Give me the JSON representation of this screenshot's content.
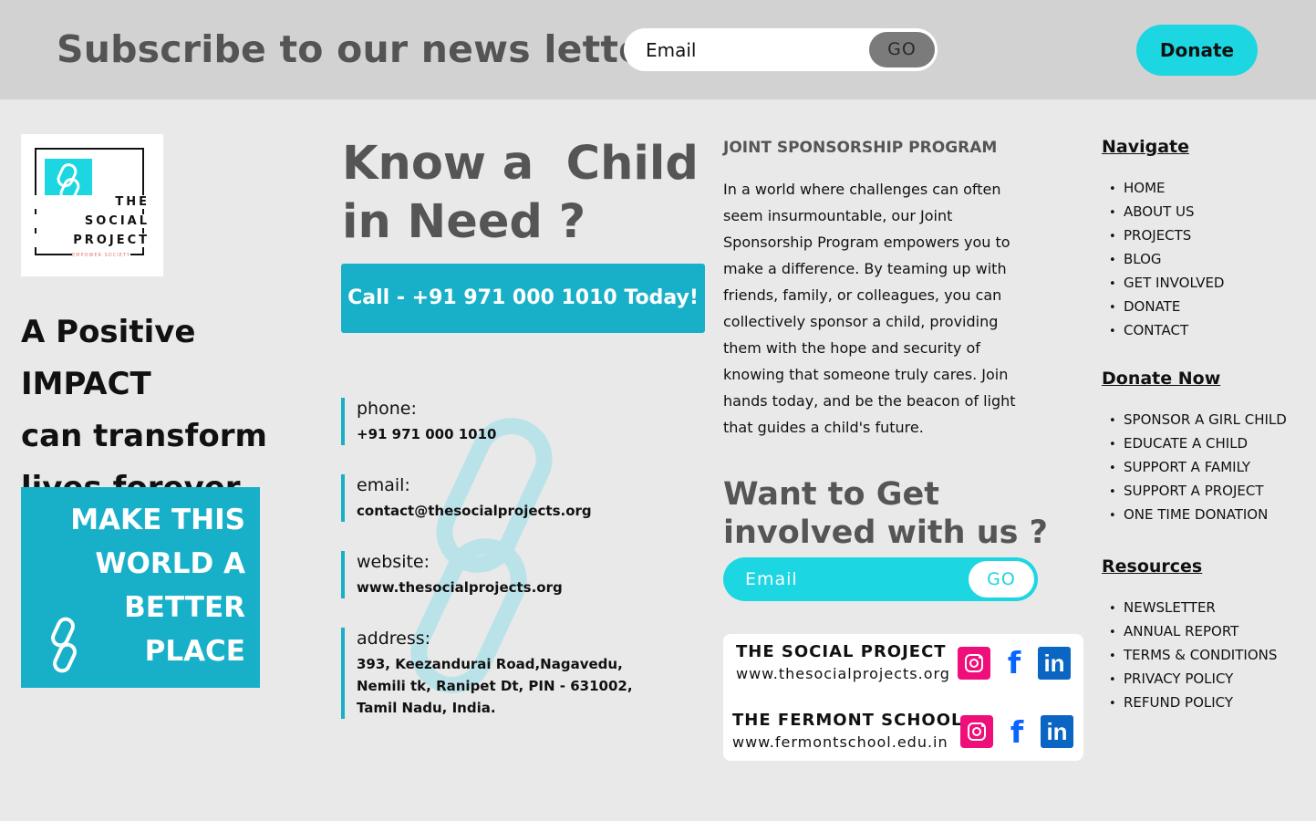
{
  "top_bar": {
    "title": "Subscribe to our news letter",
    "email_placeholder": "Email",
    "go_label": "GO",
    "donate_label": "Donate"
  },
  "brand": {
    "logo_line1": "THE",
    "logo_line2": "SOCIAL",
    "logo_line3": "PROJECT",
    "logo_sub": "EMPOWER SOCIETY",
    "tagline_lines": [
      "A Positive IMPACT",
      "can transform",
      "lives forever"
    ],
    "cta_lines": [
      "MAKE THIS",
      "WORLD A",
      "BETTER",
      "PLACE"
    ]
  },
  "know_child": {
    "title_line1": "Know a  Child",
    "title_line2": "in Need ?",
    "call_label": "Call - +91 971 000 1010 Today!"
  },
  "contacts": {
    "phone_label": "phone:",
    "phone_value": "+91 971 000 1010",
    "email_label": "email:",
    "email_value": "contact@thesocialprojects.org",
    "website_label": "website:",
    "website_value": "www.thesocialprojects.org",
    "address_label": "address:",
    "address_line1": "393, Keezandurai Road,Nagavedu,",
    "address_line2": "Nemili tk, Ranipet Dt, PIN - 631002,",
    "address_line3": "Tamil Nadu, India."
  },
  "sponsorship": {
    "title": "JOINT SPONSORSHIP PROGRAM",
    "body": "In a world where challenges can often seem insurmountable, our Joint Sponsorship Program empowers you to make a difference. By teaming up with friends, family, or colleagues, you can collectively sponsor a child, providing them with the hope and security of knowing that someone truly cares. Join hands today, and be the beacon of light that guides a child's future."
  },
  "get_involved": {
    "title_line1": "Want to Get",
    "title_line2": "involved with us ?",
    "email_placeholder": "Email",
    "go_label": "GO"
  },
  "social": {
    "org1_name": "THE SOCIAL PROJECT",
    "org1_url": "www.thesocialprojects.org",
    "org2_name": "THE FERMONT SCHOOL",
    "org2_url": "www.fermontschool.edu.in",
    "facebook_glyph": "f",
    "linkedin_glyph": "in",
    "colors": {
      "instagram": "#ef0f7a",
      "facebook": "#0866ff",
      "linkedin": "#0a66c2"
    }
  },
  "navigate": {
    "heading": "Navigate",
    "items": [
      "HOME",
      "ABOUT US",
      "PROJECTS",
      "BLOG",
      "GET INVOLVED",
      "DONATE",
      "CONTACT"
    ]
  },
  "donate_now": {
    "heading": "Donate Now",
    "items": [
      "SPONSOR A GIRL CHILD",
      "EDUCATE A CHILD",
      "SUPPORT A FAMILY",
      "SUPPORT A PROJECT",
      "ONE TIME DONATION"
    ]
  },
  "resources": {
    "heading": "Resources",
    "items": [
      "NEWSLETTER",
      "ANNUAL REPORT",
      "TERMS & CONDITIONS",
      "PRIVACY POLICY",
      "REFUND POLICY"
    ]
  },
  "theme": {
    "accent": "#18b0c8",
    "cyan": "#1cd6e2",
    "heading_gray": "#555555",
    "topbar_bg": "#d2d2d2",
    "page_bg": "#e9e9e9"
  }
}
